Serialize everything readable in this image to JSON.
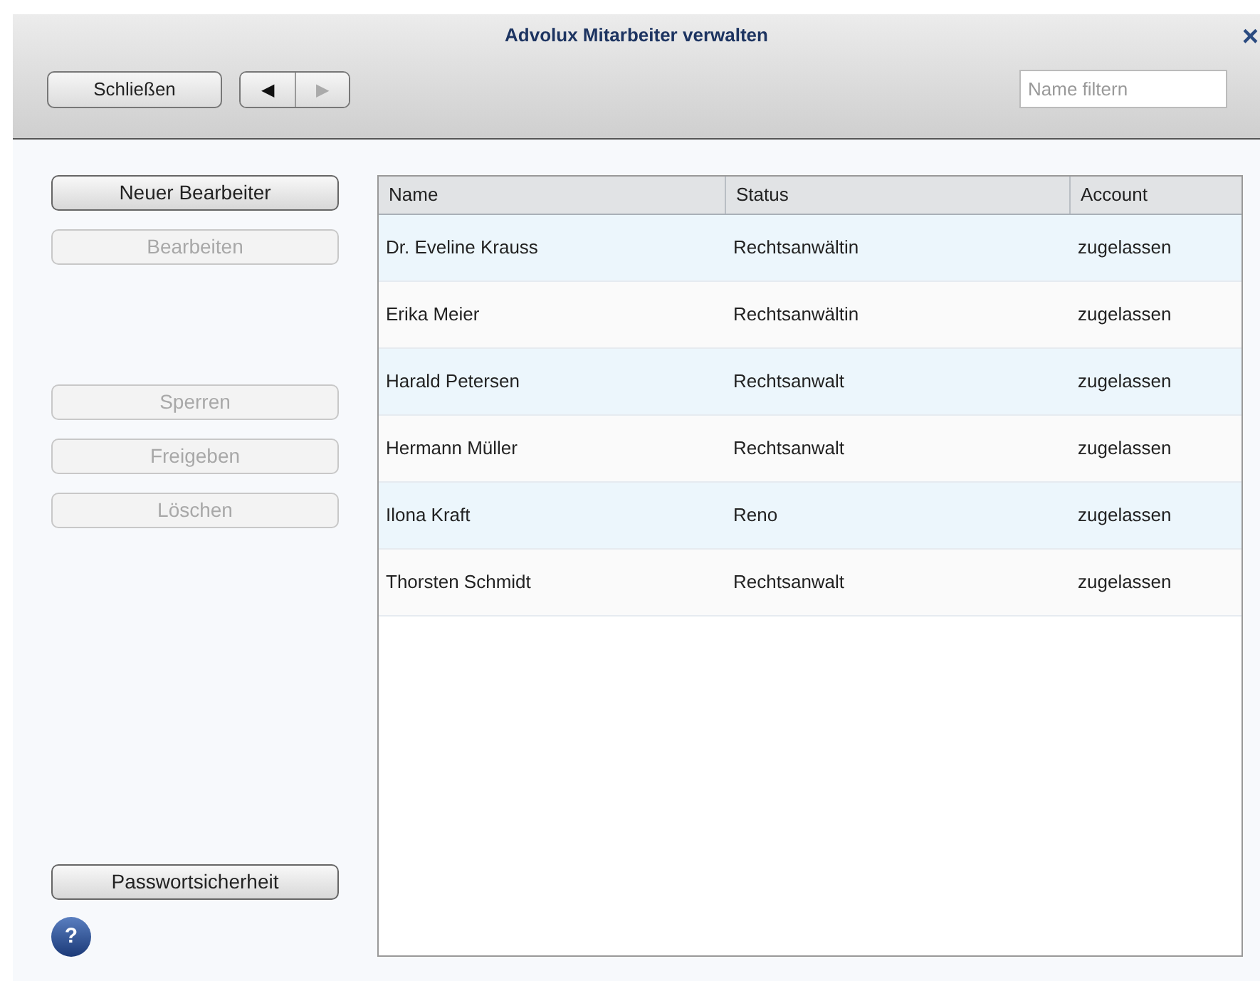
{
  "window": {
    "title": "Advolux Mitarbeiter verwalten",
    "close": "×"
  },
  "toolbar": {
    "close_button": "Schließen",
    "nav": [
      {
        "label": "◀",
        "disabled": false
      },
      {
        "label": "▶",
        "disabled": true
      }
    ],
    "filter": {
      "placeholder": "Name filtern"
    }
  },
  "actions_top": [
    {
      "label": "Neuer Bearbeiter",
      "disabled": false
    },
    {
      "label": "Bearbeiten",
      "disabled": true
    }
  ],
  "actions_middle": [
    {
      "label": "Sperren",
      "disabled": true
    },
    {
      "label": "Freigeben",
      "disabled": true
    },
    {
      "label": "Löschen",
      "disabled": true
    }
  ],
  "bottom_button": "Passwortsicherheit",
  "help": "?",
  "table": {
    "columns": [
      "Name",
      "Status",
      "Account"
    ],
    "rows": [
      [
        "Dr. Eveline Krauss",
        "Rechtsanwältin",
        "zugelassen"
      ],
      [
        "Erika Meier",
        "Rechtsanwältin",
        "zugelassen"
      ],
      [
        "Harald Petersen",
        "Rechtsanwalt",
        "zugelassen"
      ],
      [
        "Hermann Müller",
        "Rechtsanwalt",
        "zugelassen"
      ],
      [
        "Ilona Kraft",
        "Reno",
        "zugelassen"
      ],
      [
        "Thorsten Schmidt",
        "Rechtsanwalt",
        "zugelassen"
      ]
    ]
  }
}
